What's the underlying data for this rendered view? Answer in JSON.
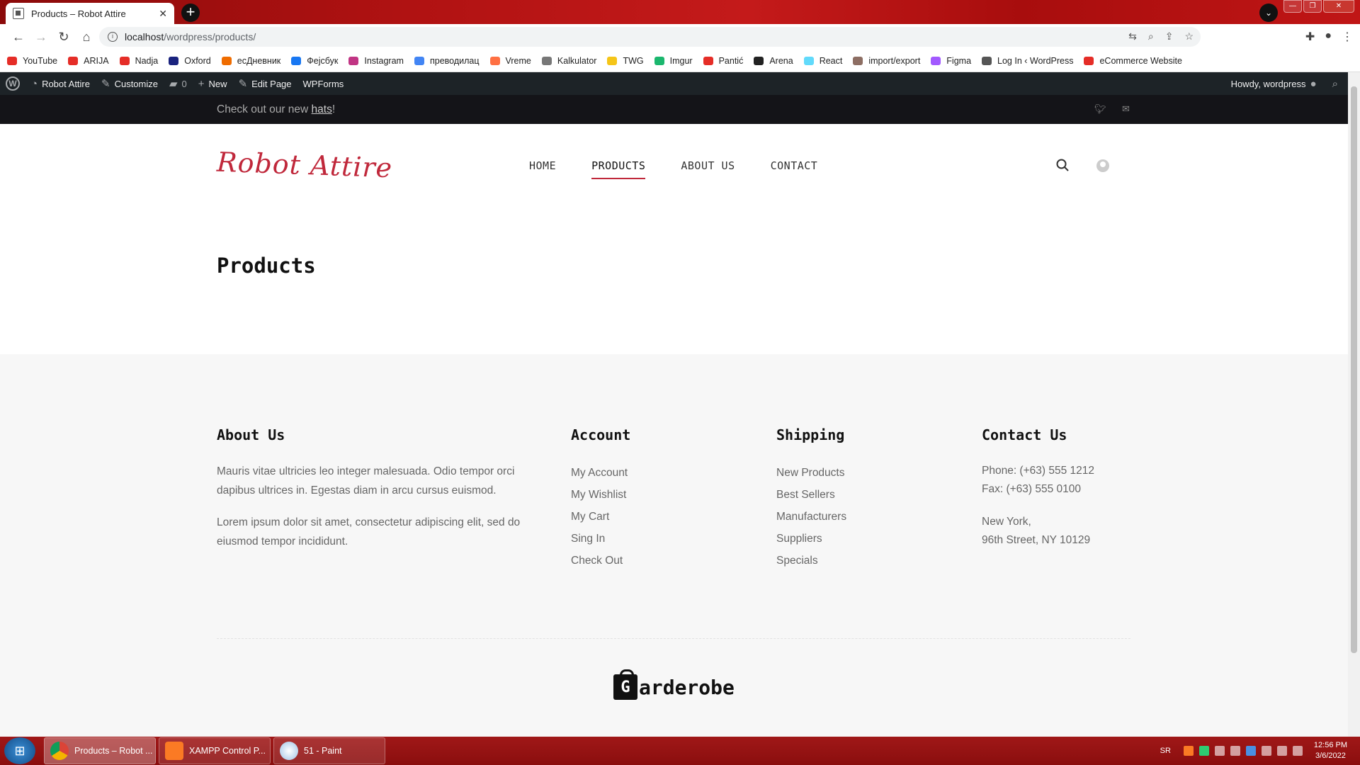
{
  "browser": {
    "tab_title": "Products – Robot Attire",
    "url_host": "localhost",
    "url_path": "/wordpress/products/",
    "bookmarks": [
      "YouTube",
      "ARIJA",
      "Nadja",
      "Oxford",
      "есДневник",
      "Фејсбук",
      "Instagram",
      "преводилац",
      "Vreme",
      "Kalkulator",
      "TWG",
      "Imgur",
      "Pantić",
      "Arena",
      "React",
      "import/export",
      "Figma",
      "Log In ‹ WordPress",
      "eCommerce Website"
    ],
    "bookmark_colors": [
      "#e52d27",
      "#e52d27",
      "#e52d27",
      "#1a237e",
      "#ef6c00",
      "#1877f2",
      "#c13584",
      "#4285f4",
      "#ff7043",
      "#777777",
      "#f5c518",
      "#1bb76e",
      "#e52d27",
      "#222222",
      "#61dafb",
      "#8d6e63",
      "#a259ff",
      "#555555",
      "#e52d27"
    ]
  },
  "wpbar": {
    "site": "Robot Attire",
    "customize": "Customize",
    "comments": "0",
    "new": "New",
    "edit": "Edit Page",
    "wpforms": "WPForms",
    "howdy": "Howdy, wordpress"
  },
  "site": {
    "announcement_prefix": "Check out our new ",
    "announcement_link": "hats",
    "announcement_suffix": "!",
    "logo_a": "Robot",
    "logo_b": "Attire",
    "nav": [
      "HOME",
      "PRODUCTS",
      "ABOUT US",
      "CONTACT"
    ],
    "active_nav": "PRODUCTS",
    "page_title": "Products"
  },
  "footer": {
    "about_title": "About Us",
    "about_p1": "Mauris vitae ultricies leo integer malesuada. Odio tempor orci dapibus ultrices in. Egestas diam in arcu cursus euismod.",
    "about_p2": "Lorem ipsum dolor sit amet, consectetur adipiscing elit, sed do eiusmod tempor incididunt.",
    "account_title": "Account",
    "account_links": [
      "My Account",
      "My Wishlist",
      "My Cart",
      "Sing In",
      "Check Out"
    ],
    "shipping_title": "Shipping",
    "shipping_links": [
      "New Products",
      "Best Sellers",
      "Manufacturers",
      "Suppliers",
      "Specials"
    ],
    "contact_title": "Contact Us",
    "phone": "Phone: (+63) 555 1212",
    "fax": "Fax: (+63) 555 0100",
    "city": "New York,",
    "street": "96th Street, NY 10129",
    "brand_letter": "G",
    "brand_rest": "arderobe"
  },
  "taskbar": {
    "items": [
      "Products – Robot ...",
      "XAMPP Control P...",
      "51 - Paint"
    ],
    "lang": "SR",
    "time": "12:56 PM",
    "date": "3/6/2022"
  }
}
